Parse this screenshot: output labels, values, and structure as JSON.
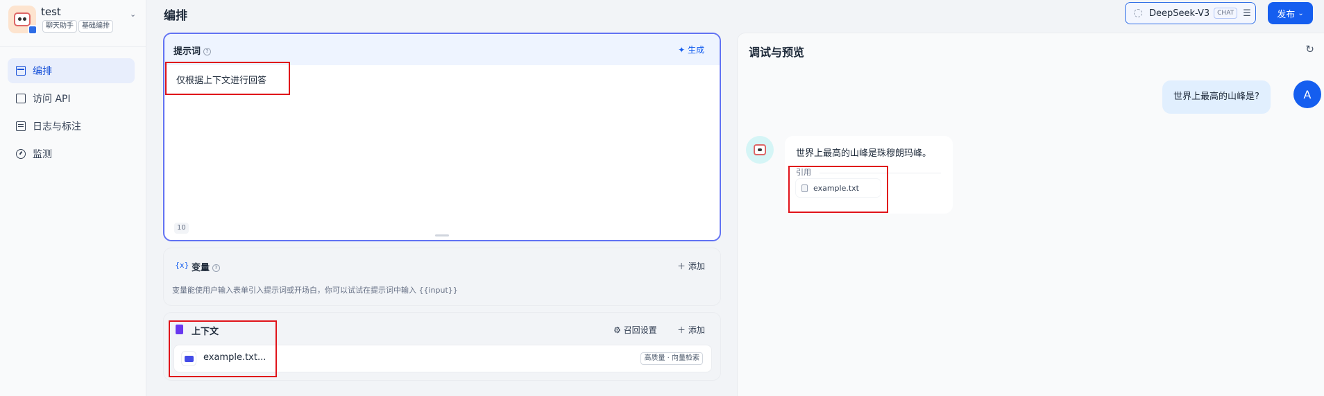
{
  "app": {
    "name": "test",
    "tags": [
      "聊天助手",
      "基础编排"
    ]
  },
  "sidebar": {
    "items": [
      {
        "label": "编排",
        "icon": "layout-icon",
        "active": true
      },
      {
        "label": "访问 API",
        "icon": "terminal-icon",
        "active": false
      },
      {
        "label": "日志与标注",
        "icon": "document-icon",
        "active": false
      },
      {
        "label": "监测",
        "icon": "gauge-icon",
        "active": false
      }
    ]
  },
  "header": {
    "title": "编排",
    "model": {
      "name": "DeepSeek-V3",
      "mode": "CHAT"
    },
    "publish_label": "发布"
  },
  "prompt": {
    "title": "提示词",
    "generate_label": "生成",
    "text": "仅根据上下文进行回答",
    "count": "10"
  },
  "variables": {
    "title": "变量",
    "add_label": "添加",
    "description": "变量能使用户输入表单引入提示词或开场白，你可以试试在提示词中输入 {{input}}"
  },
  "context": {
    "title": "上下文",
    "recall_label": "召回设置",
    "add_label": "添加",
    "file": {
      "name": "example.txt...",
      "tag": "高质量 · 向量检索"
    }
  },
  "debug": {
    "title": "调试与预览",
    "user_avatar": "A",
    "user_message": "世界上最高的山峰是?",
    "bot_message": "世界上最高的山峰是珠穆朗玛峰。",
    "citation_label": "引用",
    "citation_file": "example.txt"
  },
  "colors": {
    "accent": "#155eef",
    "highlight": "#e0131a",
    "active_nav_bg": "#e8eefc"
  }
}
